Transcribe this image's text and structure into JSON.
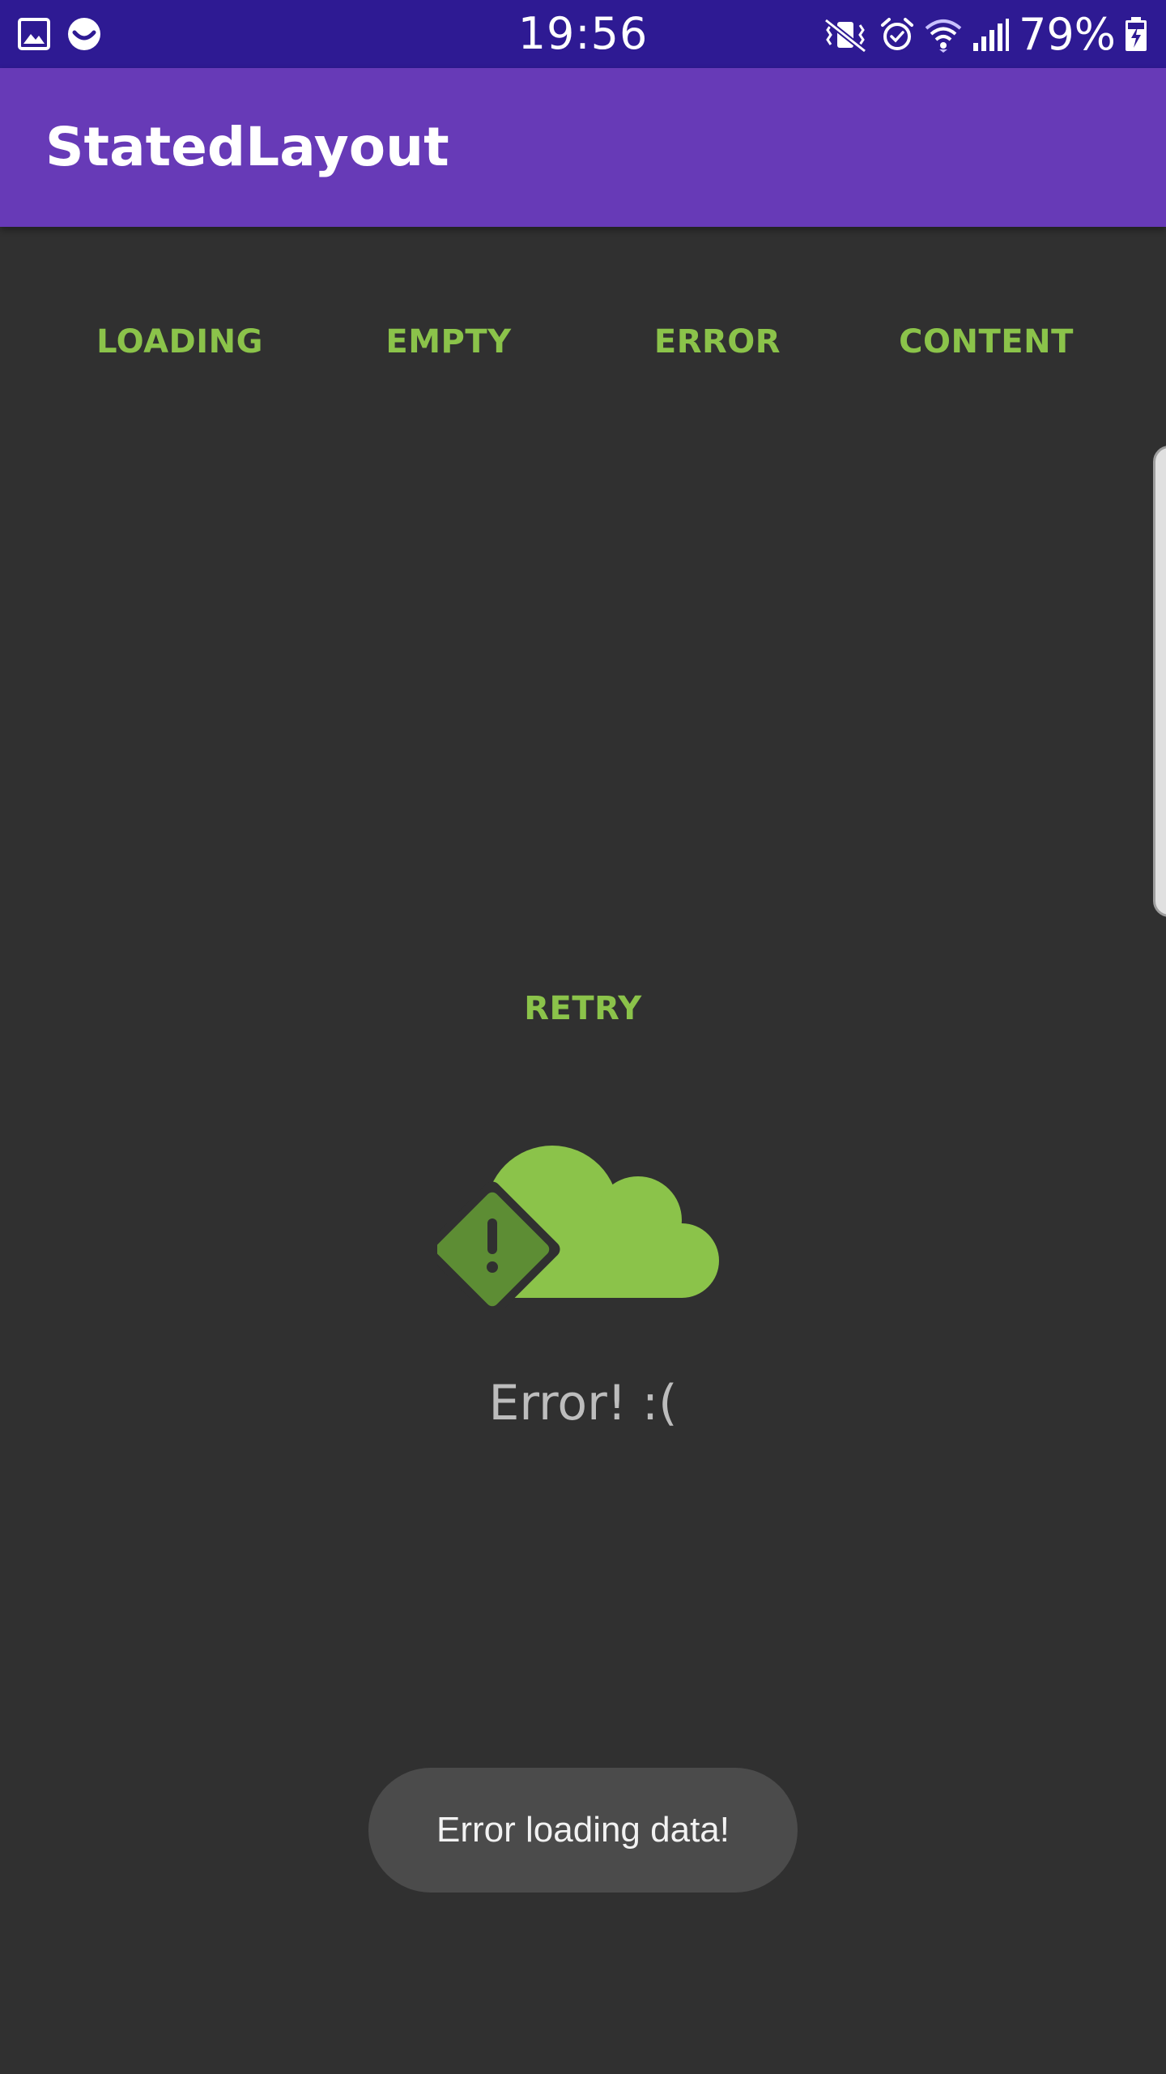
{
  "status_bar": {
    "time": "19:56",
    "battery": "79%",
    "left_icons": [
      "gallery-icon",
      "smiley-icon"
    ],
    "right_icons": [
      "mute-vibrate-icon",
      "alarm-icon",
      "wifi-icon",
      "signal-icon",
      "battery-charging-icon"
    ]
  },
  "app_bar": {
    "title": "StatedLayout"
  },
  "state_buttons": {
    "loading": "LOADING",
    "empty": "EMPTY",
    "error": "ERROR",
    "content": "CONTENT"
  },
  "error_state": {
    "retry_label": "RETRY",
    "icon": "cloud-warning-icon",
    "message": "Error! :("
  },
  "toast": {
    "message": "Error loading data!"
  },
  "colors": {
    "status_bar": "#2e1a93",
    "app_bar": "#673ab7",
    "background": "#303030",
    "accent": "#8bc34a",
    "accent_dark": "#5d8d34",
    "error_text": "#bdbdbd",
    "toast_bg": "#4b4b4b"
  }
}
